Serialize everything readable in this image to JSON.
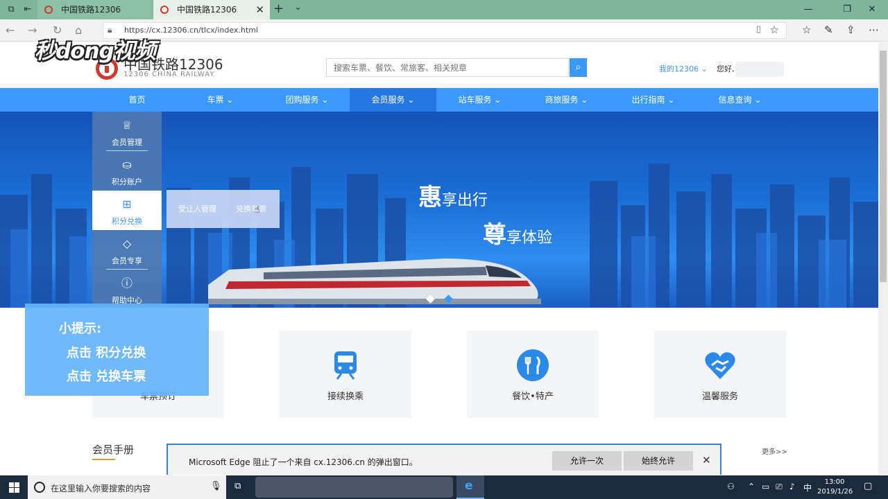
{
  "browser": {
    "tabs": [
      {
        "title": "中国铁路12306"
      },
      {
        "title": "中国铁路12306"
      }
    ],
    "url": "https://cx.12306.cn/tlcx/index.html"
  },
  "watermark": "秒dong视频",
  "header": {
    "logo_title": "中国铁路12306",
    "logo_subtitle": "12306 CHINA RAILWAY",
    "search_placeholder": "搜索车票、餐饮、常旅客、相关规章",
    "my12306": "我的12306",
    "greeting": "您好,"
  },
  "nav": {
    "items": [
      {
        "label": "首页"
      },
      {
        "label": "车票"
      },
      {
        "label": "团购服务"
      },
      {
        "label": "会员服务"
      },
      {
        "label": "站车服务"
      },
      {
        "label": "商旅服务"
      },
      {
        "label": "出行指南"
      },
      {
        "label": "信息查询"
      }
    ],
    "active_index": 3
  },
  "banner": {
    "slogan1_big": "惠",
    "slogan1_rest": "享出行",
    "slogan2_big": "尊",
    "slogan2_rest": "享体验"
  },
  "sidemenu": {
    "items": [
      {
        "label": "会员管理",
        "icon": "crown-icon"
      },
      {
        "label": "积分账户",
        "icon": "points-account-icon"
      },
      {
        "label": "积分兑换",
        "icon": "gift-icon"
      },
      {
        "label": "会员专享",
        "icon": "diamond-icon"
      },
      {
        "label": "帮助中心",
        "icon": "help-icon"
      }
    ],
    "selected_index": 2
  },
  "submenu": {
    "items": [
      {
        "label": "受让人管理"
      },
      {
        "label": "兑换车票"
      }
    ]
  },
  "cards": [
    {
      "label": "车票预订"
    },
    {
      "label": "接续换乘"
    },
    {
      "label": "餐饮•特产"
    },
    {
      "label": "温馨服务"
    }
  ],
  "tip": {
    "line1": "小提示:",
    "line2": "点击  积分兑换",
    "line3": "点击  兑换车票"
  },
  "members": {
    "title": "会员手册",
    "more": "更多>>"
  },
  "popup": {
    "message": "Microsoft Edge 阻止了一个来自 cx.12306.cn 的弹出窗口。",
    "allow_once": "允许一次",
    "always_allow": "始终允许"
  },
  "taskbar": {
    "search_placeholder": "在这里输入你要搜索的内容",
    "ime": "中",
    "time": "13:00",
    "date": "2019/1/26"
  },
  "colors": {
    "primary": "#3b99fc",
    "nav_active": "#2676e3",
    "brand_red": "#d4372c",
    "tip_bg": "#64b4fc"
  }
}
